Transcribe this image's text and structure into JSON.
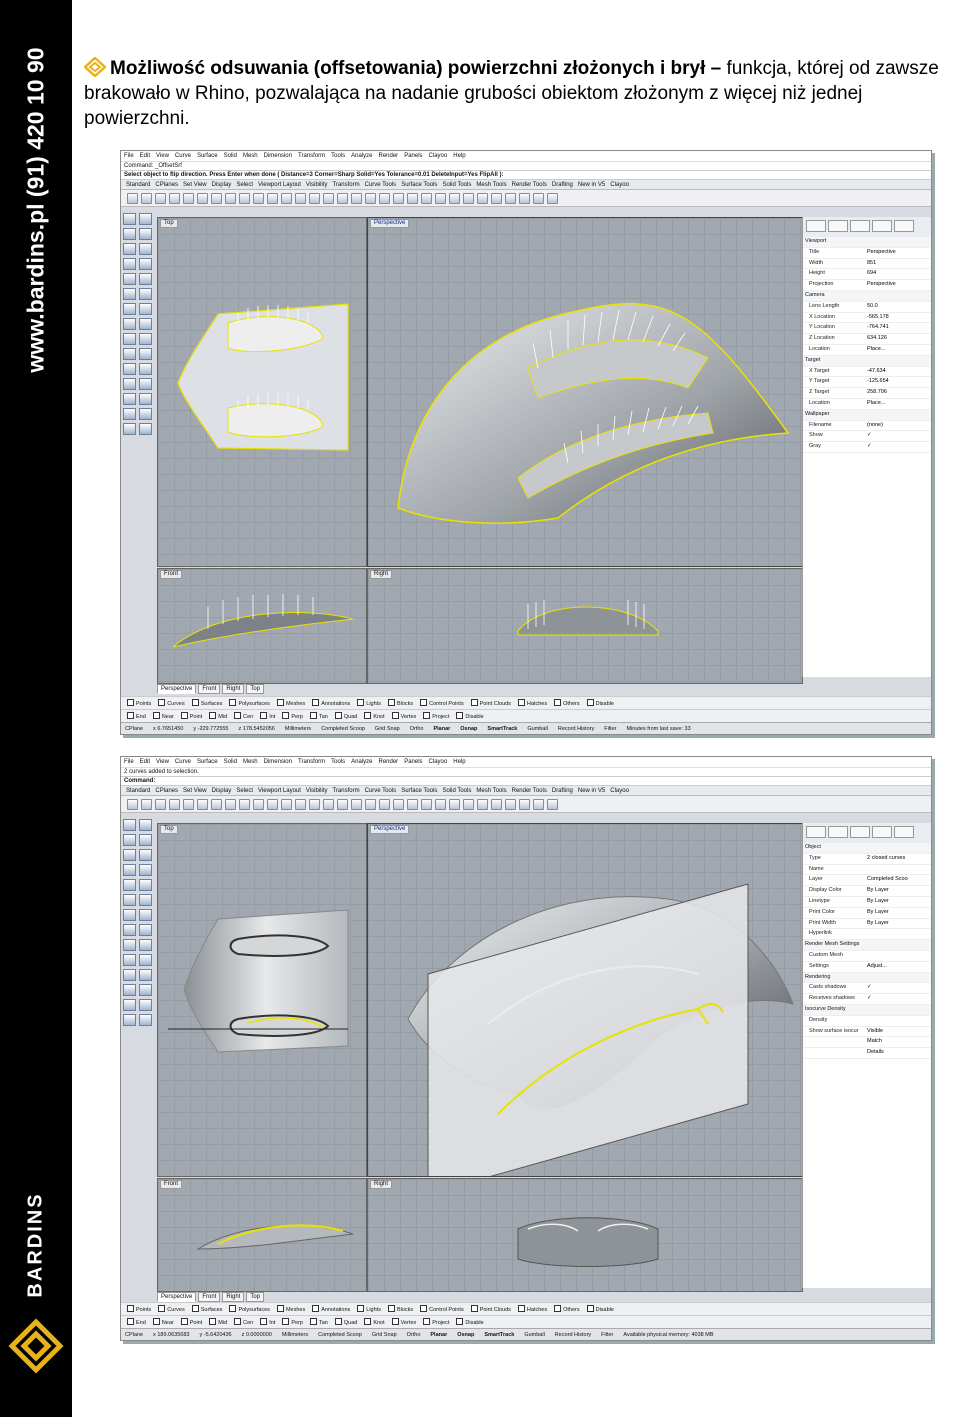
{
  "sidebar": {
    "vertical_text": "www.bardins.pl   (91) 420 10 90",
    "brand": "BARDINS"
  },
  "heading": {
    "bold": "Możliwość odsuwania (offsetowania) powierzchni złożonych i brył –",
    "normal": " funkcja, której od zawsze brakowało w Rhino, pozwalająca na nadanie grubości obiektom złożonym z więcej niż jednej powierzchni."
  },
  "menu": [
    "File",
    "Edit",
    "View",
    "Curve",
    "Surface",
    "Solid",
    "Mesh",
    "Dimension",
    "Transform",
    "Tools",
    "Analyze",
    "Render",
    "Panels",
    "Clayoo",
    "Help"
  ],
  "toolbar_tabs": [
    "Standard",
    "CPlanes",
    "Set View",
    "Display",
    "Select",
    "Viewport Layout",
    "Visibility",
    "Transform",
    "Curve Tools",
    "Surface Tools",
    "Solid Tools",
    "Mesh Tools",
    "Render Tools",
    "Drafting",
    "New in V5",
    "Clayoo"
  ],
  "viewports": {
    "top": "Top",
    "perspective": "Perspective",
    "front": "Front",
    "right": "Right"
  },
  "viewport_tabs": [
    "Perspective",
    "Front",
    "Right",
    "Top"
  ],
  "osnaps": [
    "End",
    "Near",
    "Point",
    "Mid",
    "Cen",
    "Int",
    "Perp",
    "Tan",
    "Quad",
    "Knot",
    "Vertex",
    "Project",
    "Disable"
  ],
  "filters": [
    "Points",
    "Curves",
    "Surfaces",
    "Polysurfaces",
    "Meshes",
    "Annotations",
    "Lights",
    "Blocks",
    "Control Points",
    "Point Clouds",
    "Hatches",
    "Others",
    "Disable"
  ],
  "status_items": [
    "Millimeters",
    "Completed Scoop",
    "Grid Snap",
    "Ortho",
    "Planar",
    "Osnap",
    "SmartTrack",
    "Gumball",
    "Record History",
    "Filter"
  ],
  "shot1": {
    "command": "Command: _OffsetSrf",
    "prompt": "Select object to flip direction. Press Enter when done ( Distance=3  Corner=Sharp  Solid=Yes  Tolerance=0.01  DeleteInput=Yes  FlipAll ):",
    "props": [
      {
        "sec": "Viewport"
      },
      {
        "k": "Title",
        "v": "Perspective"
      },
      {
        "k": "Width",
        "v": "851"
      },
      {
        "k": "Height",
        "v": "694"
      },
      {
        "k": "Projection",
        "v": "Perspective"
      },
      {
        "sec": "Camera"
      },
      {
        "k": "Lens Length",
        "v": "50.0"
      },
      {
        "k": "X Location",
        "v": "-565.178"
      },
      {
        "k": "Y Location",
        "v": "-764.741"
      },
      {
        "k": "Z Location",
        "v": "634.126"
      },
      {
        "k": "Location",
        "v": "Place..."
      },
      {
        "sec": "Target"
      },
      {
        "k": "X Target",
        "v": "-47.634"
      },
      {
        "k": "Y Target",
        "v": "-125.654"
      },
      {
        "k": "Z Target",
        "v": "258.706"
      },
      {
        "k": "Location",
        "v": "Place..."
      },
      {
        "sec": "Wallpaper"
      },
      {
        "k": "Filename",
        "v": "(none)"
      },
      {
        "k": "Show",
        "v": "✓"
      },
      {
        "k": "Gray",
        "v": "✓"
      }
    ],
    "cplane": "CPlane",
    "x": "x 6.7651450",
    "y": "y -229.772555",
    "z": "z 178.5452056",
    "memory": "Minutes from last save: 33"
  },
  "shot2": {
    "command": "2 curves added to selection.",
    "prompt": "Command:",
    "props": [
      {
        "sec": "Object"
      },
      {
        "k": "Type",
        "v": "2 closed curves"
      },
      {
        "k": "Name",
        "v": ""
      },
      {
        "k": "Layer",
        "v": "Completed Scoo"
      },
      {
        "k": "Display Color",
        "v": "By Layer"
      },
      {
        "k": "Linetype",
        "v": "By Layer"
      },
      {
        "k": "Print Color",
        "v": "By Layer"
      },
      {
        "k": "Print Width",
        "v": "By Layer"
      },
      {
        "k": "Hyperlink",
        "v": ""
      },
      {
        "sec": "Render Mesh Settings"
      },
      {
        "k": "Custom Mesh",
        "v": ""
      },
      {
        "k": "Settings",
        "v": "Adjust..."
      },
      {
        "sec": "Rendering"
      },
      {
        "k": "Casts shadows",
        "v": "✓"
      },
      {
        "k": "Receives shadows",
        "v": "✓"
      },
      {
        "sec": "Isocurve Density"
      },
      {
        "k": "Density",
        "v": ""
      },
      {
        "k": "Show surface isocur",
        "v": "Visible"
      },
      {
        "k": "",
        "v": "Match"
      },
      {
        "k": "",
        "v": "Details"
      }
    ],
    "cplane": "CPlane",
    "x": "x 189.0635683",
    "y": "y -5.6420436",
    "z": "z 0.0000000",
    "memory": "Available physical memory: 4038 MB"
  }
}
